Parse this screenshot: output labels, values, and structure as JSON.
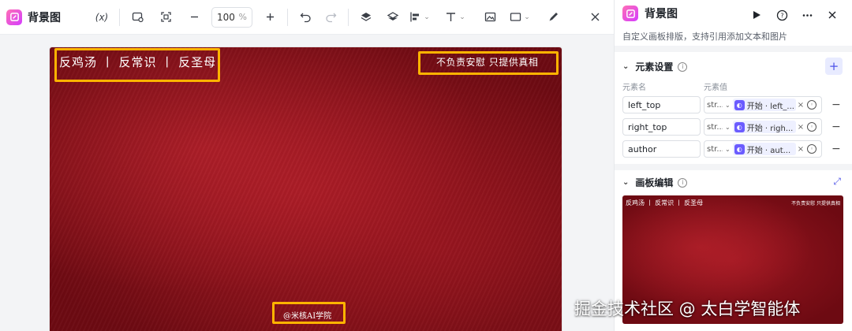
{
  "app": {
    "title": "背景图"
  },
  "toolbar": {
    "variable_label": "(x)",
    "zoom_value": "100",
    "zoom_unit": "%"
  },
  "canvas": {
    "left_top_text": "反鸡汤 丨 反常识 丨 反圣母",
    "right_top_text": "不负责安慰 只提供真相",
    "author_text": "@米核AI学院",
    "highlight_color": "#ffb400",
    "background_color": "#8b1219"
  },
  "panel": {
    "title": "背景图",
    "description": "自定义画板排版，支持引用添加文本和图片",
    "elements_section": {
      "title": "元素设置",
      "col_name": "元素名",
      "col_value": "元素值",
      "rows": [
        {
          "name": "left_top",
          "type": "str...",
          "ref": "开始 · left_...",
          "chip_close": "×"
        },
        {
          "name": "right_top",
          "type": "str...",
          "ref": "开始 · righ...",
          "chip_close": "×"
        },
        {
          "name": "author",
          "type": "str...",
          "ref": "开始 · aut...",
          "chip_close": "×"
        }
      ]
    },
    "canvas_section": {
      "title": "画板编辑"
    },
    "preview": {
      "left_text": "反鸡汤 丨 反常识 丨 反圣母",
      "right_text": "不负责安慰 只提供真相"
    }
  },
  "watermark": "掘金技术社区 @ 太白学智能体"
}
